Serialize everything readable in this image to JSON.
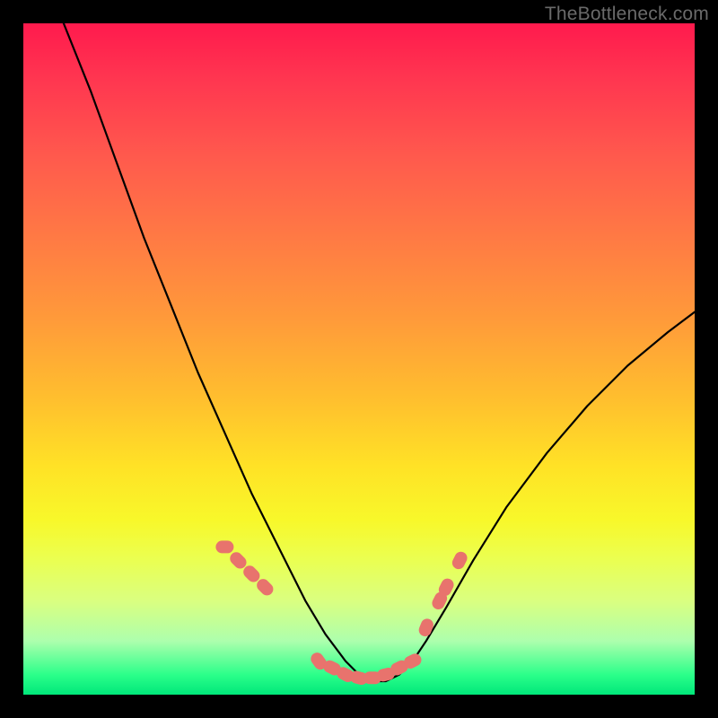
{
  "watermark": "TheBottleneck.com",
  "chart_data": {
    "type": "line",
    "title": "",
    "xlabel": "",
    "ylabel": "",
    "xlim": [
      0,
      100
    ],
    "ylim": [
      0,
      100
    ],
    "series": [
      {
        "name": "bottleneck-curve",
        "color": "#000000",
        "x": [
          6,
          10,
          14,
          18,
          22,
          26,
          30,
          34,
          38,
          42,
          45,
          48,
          50,
          52,
          54,
          56,
          58,
          60,
          63,
          67,
          72,
          78,
          84,
          90,
          96,
          100
        ],
        "y": [
          100,
          90,
          79,
          68,
          58,
          48,
          39,
          30,
          22,
          14,
          9,
          5,
          3,
          2,
          2,
          3,
          5,
          8,
          13,
          20,
          28,
          36,
          43,
          49,
          54,
          57
        ]
      }
    ],
    "overlay_points": {
      "name": "highlight-dots",
      "color": "#e8736d",
      "x": [
        30,
        32,
        34,
        36,
        44,
        46,
        48,
        50,
        52,
        54,
        56,
        58,
        60,
        62,
        63,
        65
      ],
      "y": [
        22,
        20,
        18,
        16,
        5,
        4,
        3,
        2.5,
        2.5,
        3,
        4,
        5,
        10,
        14,
        16,
        20
      ]
    },
    "gradient_stops": [
      {
        "pos": 0,
        "color": "#ff1a4d"
      },
      {
        "pos": 20,
        "color": "#ff5a4d"
      },
      {
        "pos": 44,
        "color": "#ff9a3a"
      },
      {
        "pos": 66,
        "color": "#ffe226"
      },
      {
        "pos": 80,
        "color": "#eaff52"
      },
      {
        "pos": 92,
        "color": "#adffad"
      },
      {
        "pos": 100,
        "color": "#00e77a"
      }
    ]
  }
}
